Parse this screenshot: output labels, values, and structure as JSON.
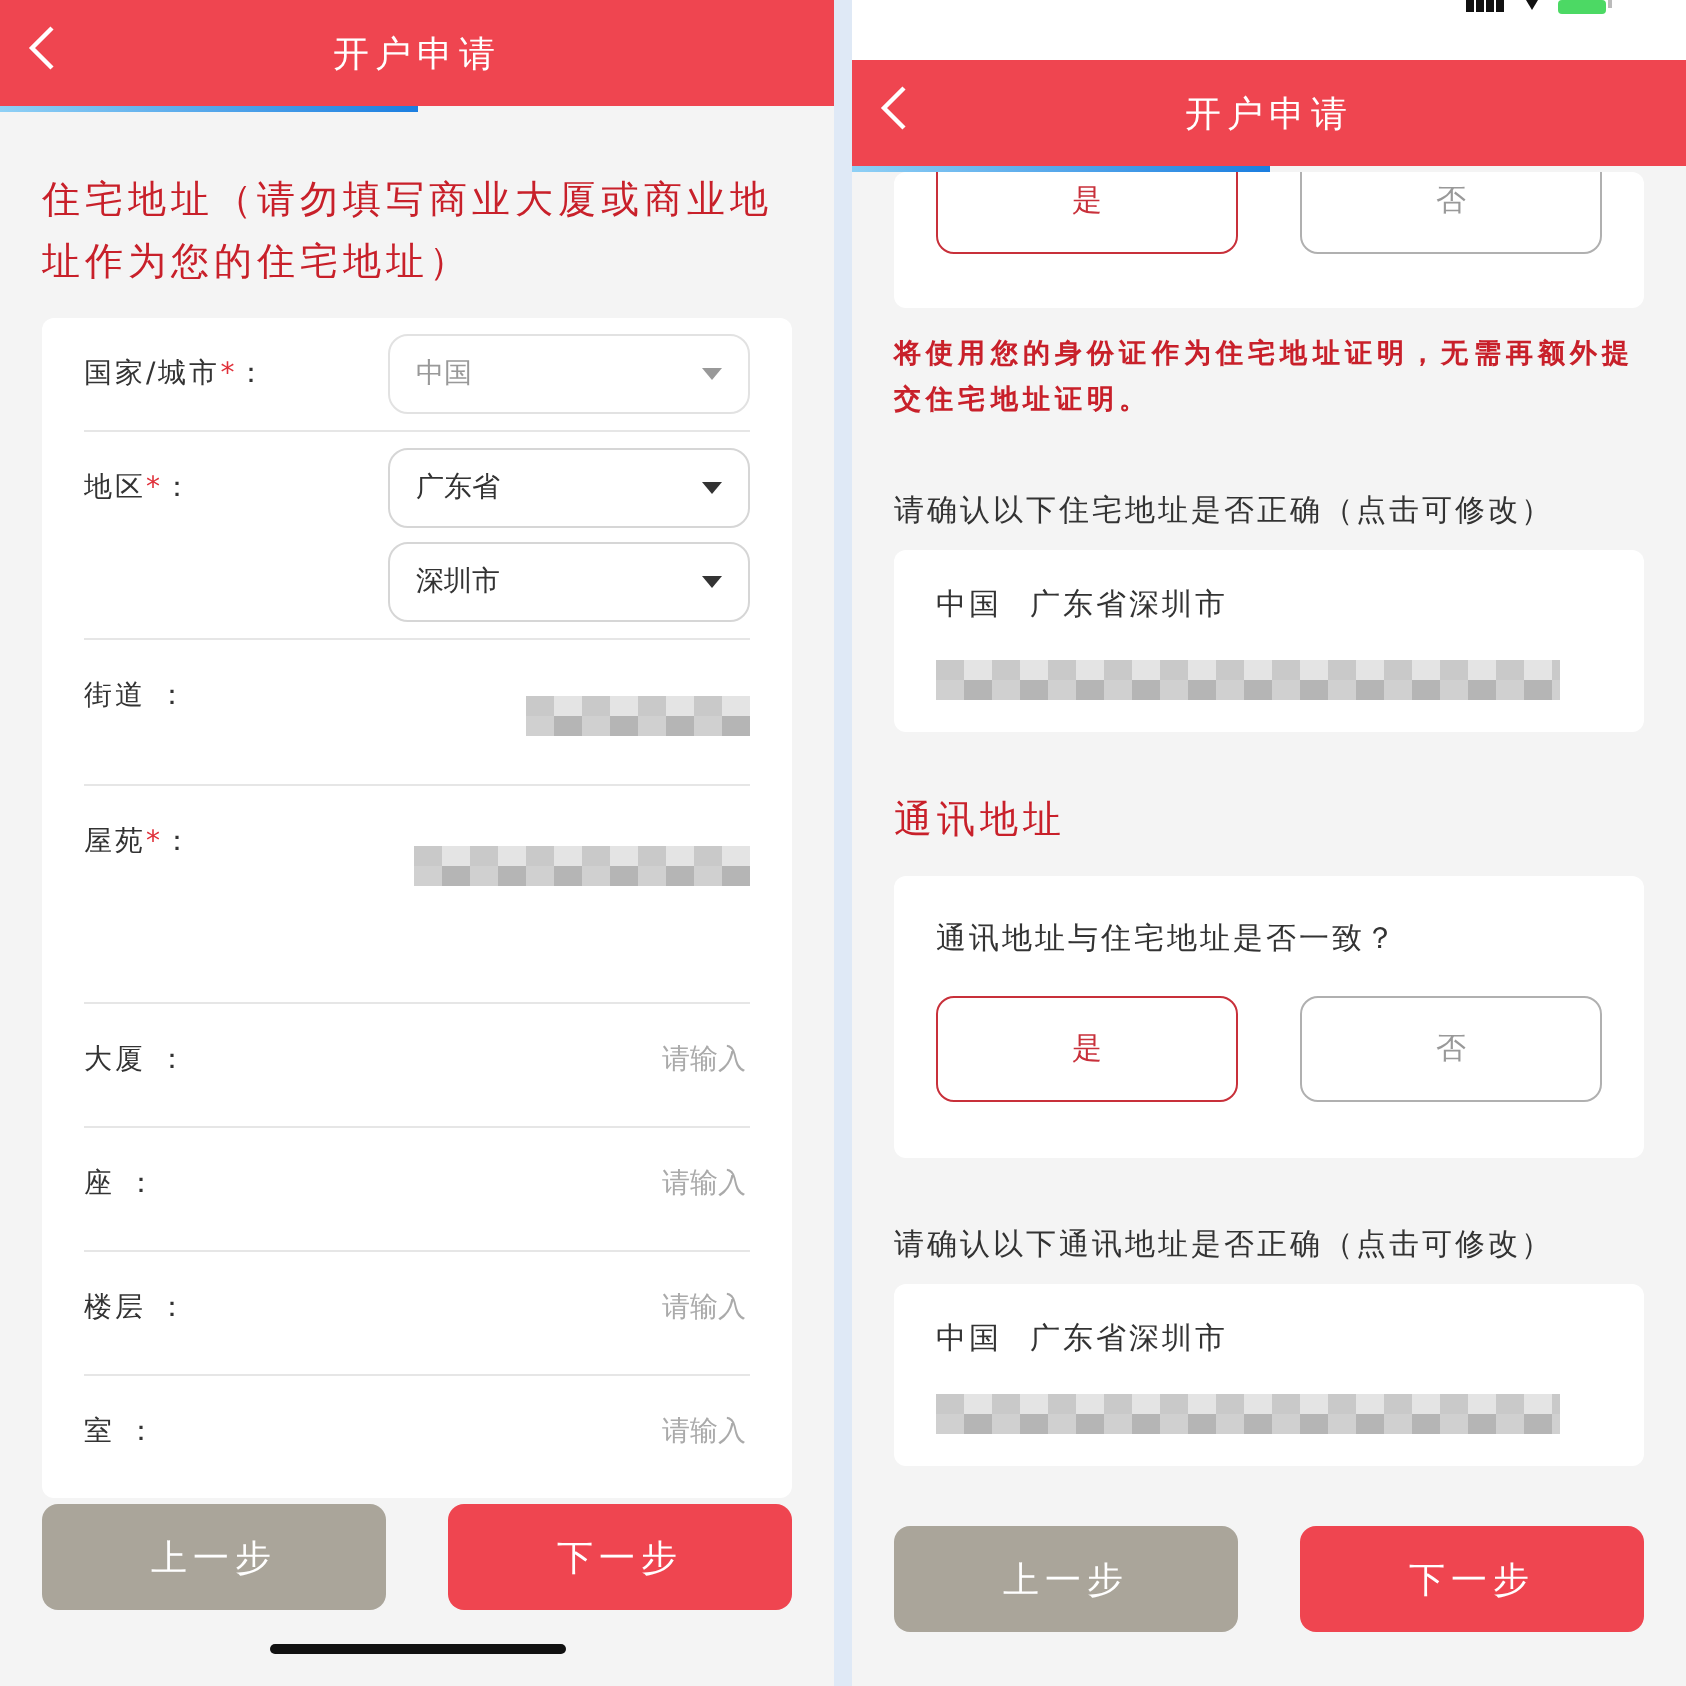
{
  "screens": [
    {
      "title": "开户申请",
      "status_bar": false,
      "home_indicator": true,
      "progress": {
        "level": 0.5
      },
      "items": [
        {
          "kind": "section",
          "text": "住宅地址（请勿填写商业大厦或商业地址作为您的住宅地址）"
        },
        {
          "kind": "form",
          "fields": [
            {
              "kind": "select",
              "label": "国家/城市",
              "required": "*",
              "colon": "：",
              "selects": [
                {
                  "value": "中国",
                  "disabled": true
                }
              ]
            },
            {
              "kind": "select",
              "label": "地区",
              "required": "*",
              "colon": "：",
              "selects": [
                {
                  "value": "广东省",
                  "disabled": false
                },
                {
                  "value": "深圳市",
                  "disabled": false
                }
              ]
            },
            {
              "kind": "blurred",
              "label": "街道",
              "colon": " ："
            },
            {
              "kind": "blurred_tall",
              "label": "屋苑",
              "required": "*",
              "colon": "："
            },
            {
              "kind": "input",
              "label": "大厦",
              "colon": " ：",
              "placeholder": "请输入"
            },
            {
              "kind": "input",
              "label": "座",
              "colon": " ：",
              "placeholder": "请输入"
            },
            {
              "kind": "input",
              "label": "楼层",
              "colon": " ：",
              "placeholder": "请输入"
            },
            {
              "kind": "input",
              "label": "室",
              "colon": " ：",
              "placeholder": "请输入"
            }
          ]
        }
      ],
      "buttons": [
        {
          "label": "上一步",
          "kind": "secondary"
        },
        {
          "label": "下一步",
          "kind": "primary"
        }
      ]
    },
    {
      "title": "开户申请",
      "status_bar": true,
      "home_indicator": false,
      "progress": {
        "level": 0.5
      },
      "items": [
        {
          "kind": "choice",
          "options": [
            {
              "label": "是",
              "selected": true
            },
            {
              "label": "否",
              "selected": false
            }
          ]
        },
        {
          "kind": "notice",
          "text": "将使用您的身份证作为住宅地址证明，无需再额外提交住宅地址证明。"
        },
        {
          "kind": "caption",
          "text": "请确认以下住宅地址是否正确（点击可修改）"
        },
        {
          "kind": "address",
          "country": "中国",
          "region": "广东省深圳市"
        },
        {
          "kind": "section",
          "text": "通讯地址"
        },
        {
          "kind": "question",
          "text": "通讯地址与住宅地址是否一致？",
          "options": [
            {
              "label": "是",
              "selected": true
            },
            {
              "label": "否",
              "selected": false
            }
          ]
        },
        {
          "kind": "caption",
          "text": "请确认以下通讯地址是否正确（点击可修改）"
        },
        {
          "kind": "address",
          "country": "中国",
          "region": "广东省深圳市"
        }
      ],
      "buttons": [
        {
          "label": "上一步",
          "kind": "secondary"
        },
        {
          "label": "下一步",
          "kind": "primary"
        }
      ]
    }
  ]
}
